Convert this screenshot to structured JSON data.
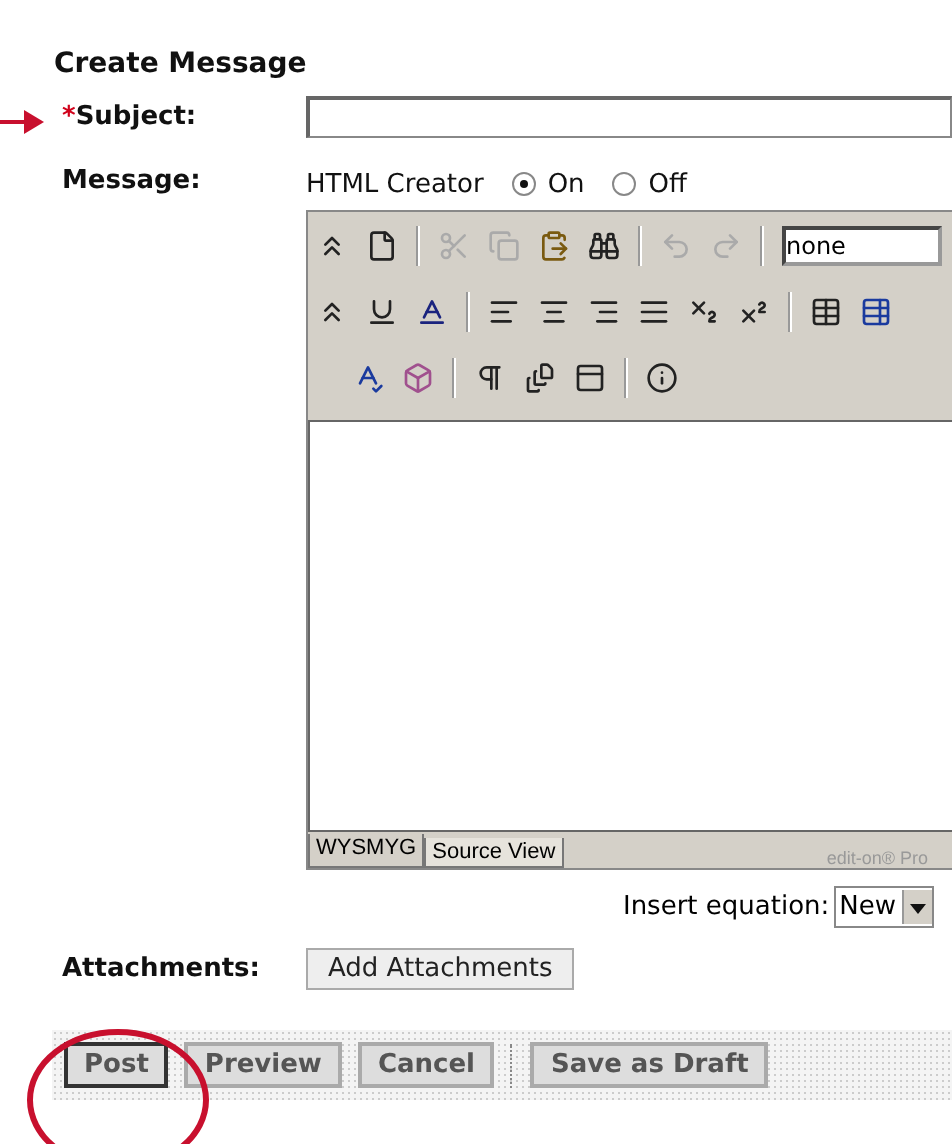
{
  "heading": "Create Message",
  "subject": {
    "label": "Subject:",
    "required": true,
    "required_mark": "*"
  },
  "message": {
    "label": "Message:"
  },
  "html_creator": {
    "label": "HTML Creator",
    "options": [
      {
        "label": "On",
        "selected": true
      },
      {
        "label": "Off",
        "selected": false
      }
    ]
  },
  "editor": {
    "format_value": "none",
    "tabs": [
      {
        "label": "WYSMYG",
        "selected": true
      },
      {
        "label": "Source View",
        "selected": false
      }
    ],
    "brand": "edit-on® Pro"
  },
  "equation": {
    "label": "Insert equation:",
    "value": "New"
  },
  "attachments": {
    "label": "Attachments:",
    "button": "Add Attachments"
  },
  "buttons": [
    {
      "label": "Post",
      "selected": true
    },
    {
      "label": "Preview",
      "selected": false
    },
    {
      "label": "Cancel",
      "selected": false
    },
    {
      "label": "Save as Draft",
      "selected": false
    }
  ]
}
